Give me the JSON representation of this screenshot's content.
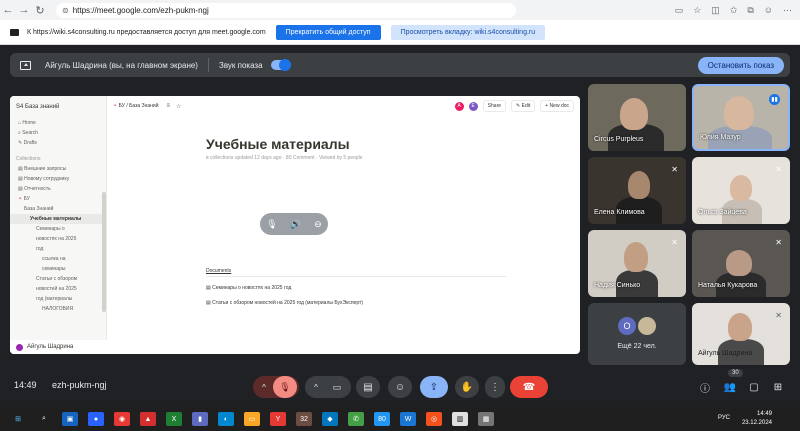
{
  "browser": {
    "url": "https://meet.google.com/ezh-pukm-ngj",
    "tool_icons": [
      "screen-icon",
      "star-icon",
      "split-icon",
      "favorites-icon",
      "collections-icon",
      "profile-icon",
      "more-icon"
    ]
  },
  "sharebar": {
    "text": "К https://wiki.s4consulting.ru предоставляется доступ для meet.google.com",
    "stop_sharing": "Прекратить общий доступ",
    "view_tab": "Просмотреть вкладку: wiki.s4consulting.ru"
  },
  "presenting": {
    "name": "Айгуль Шадрина (вы, на главном экране)",
    "sound_label": "Звук показа",
    "stop_button": "Остановить показ"
  },
  "notion": {
    "workspace": "База знаний",
    "nav": [
      "Home",
      "Search",
      "Drafts"
    ],
    "section": "Collections",
    "collections": [
      "Внешние запросы",
      "Новому сотруднику",
      "Отчетность",
      "БУ"
    ],
    "tree": [
      {
        "label": "База Знаний",
        "indent": 1,
        "selected": false
      },
      {
        "label": "Учебные материалы",
        "indent": 2,
        "selected": true
      },
      {
        "label": "Семинары о",
        "indent": 3,
        "selected": false
      },
      {
        "label": "новостях на 2025",
        "indent": 3,
        "selected": false
      },
      {
        "label": "год",
        "indent": 3,
        "selected": false
      },
      {
        "label": "ссылка на",
        "indent": 4,
        "selected": false
      },
      {
        "label": "семинары",
        "indent": 4,
        "selected": false
      },
      {
        "label": "Статьи с обзором",
        "indent": 3,
        "selected": false
      },
      {
        "label": "новостей на 2025",
        "indent": 3,
        "selected": false
      },
      {
        "label": "год (материалы",
        "indent": 3,
        "selected": false
      },
      {
        "label": "НАЛОГОВИЯ",
        "indent": 4,
        "selected": false
      }
    ],
    "user": "Айгуль Шадрина",
    "breadcrumbs": [
      "БУ",
      "База Знаний"
    ],
    "share": "Share",
    "edit": "Edit",
    "new_doc": "New doc",
    "title": "Учебные материалы",
    "meta": "в collections updated 12 days ago · 80 Comment · Viewed by 5 people",
    "section_title": "Documents",
    "docs": [
      "Семинары о новостях на 2025 год",
      "Статьи с обзором новостей на 2025 год (материалы БухЭксперт)"
    ]
  },
  "participants": [
    {
      "name": "Circus Purpleus",
      "muted": false
    },
    {
      "name": "Юлия Мазур",
      "muted": false
    },
    {
      "name": "Елена Климова",
      "muted": true
    },
    {
      "name": "Ольга Зайцева",
      "muted": true
    },
    {
      "name": "Надия Синько",
      "muted": true
    },
    {
      "name": "Наталья Кукарова",
      "muted": true
    },
    {
      "name": "Ещё 22 чел.",
      "muted": false
    },
    {
      "name": "Айгуль Шадрина",
      "muted": true
    }
  ],
  "others_avatar_letter": "O",
  "meeting": {
    "time": "14:49",
    "code": "ezh-pukm-ngj",
    "participant_count": "30"
  },
  "taskbar": {
    "lang": "РУС",
    "time": "14:49",
    "date": "23.12.2024",
    "badge1": "32",
    "badge2": "80"
  },
  "colors": {
    "meet_bg": "#202124",
    "accent": "#8ab4f8",
    "end_call": "#ea4335",
    "mic_off": "#f28b82",
    "present_active": "#8ab4f8"
  }
}
